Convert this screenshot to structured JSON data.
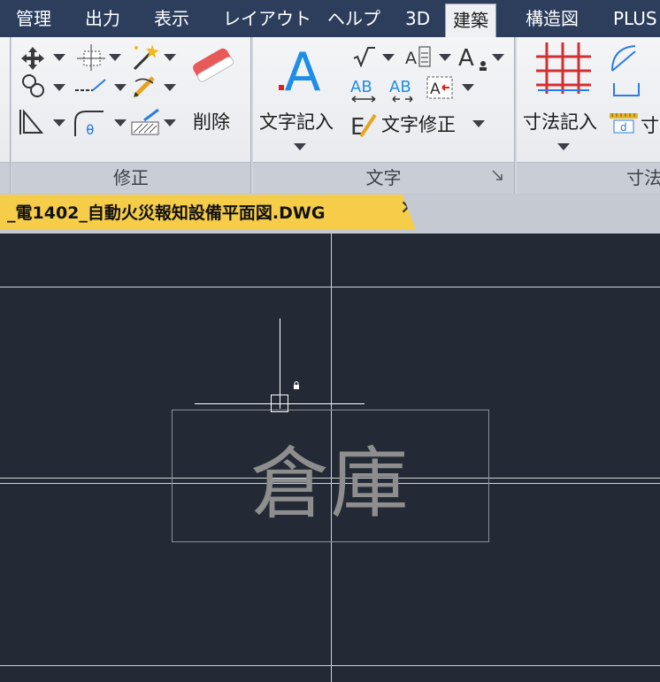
{
  "menu": {
    "tabs": [
      "管理",
      "出力",
      "表示",
      "レイアウト",
      "ヘルプ",
      "3D",
      "建築",
      "構造図",
      "PLUS"
    ],
    "active": "建築"
  },
  "ribbon": {
    "modify_panel": {
      "title": "修正",
      "delete_label": "削除"
    },
    "text_panel": {
      "title": "文字",
      "text_entry_label": "文字記入",
      "text_edit_label": "文字修正",
      "ab1": "AB",
      "ab2": "AB",
      "a_letter": "A"
    },
    "dim_panel": {
      "title": "寸法",
      "dim_entry_label": "寸法記入",
      "dim_extra": "寸",
      "d_letter": "d"
    }
  },
  "document": {
    "tab_name": "_電1402_自動火災報知設備平面図.DWG",
    "close_symbol": "✕"
  },
  "canvas": {
    "room_label": "倉庫"
  },
  "colors": {
    "canvas_bg": "#232a36",
    "menubar_bg": "#2c3e5c",
    "doc_tab": "#f6cd48",
    "accent_blue": "#1e8ee8"
  }
}
